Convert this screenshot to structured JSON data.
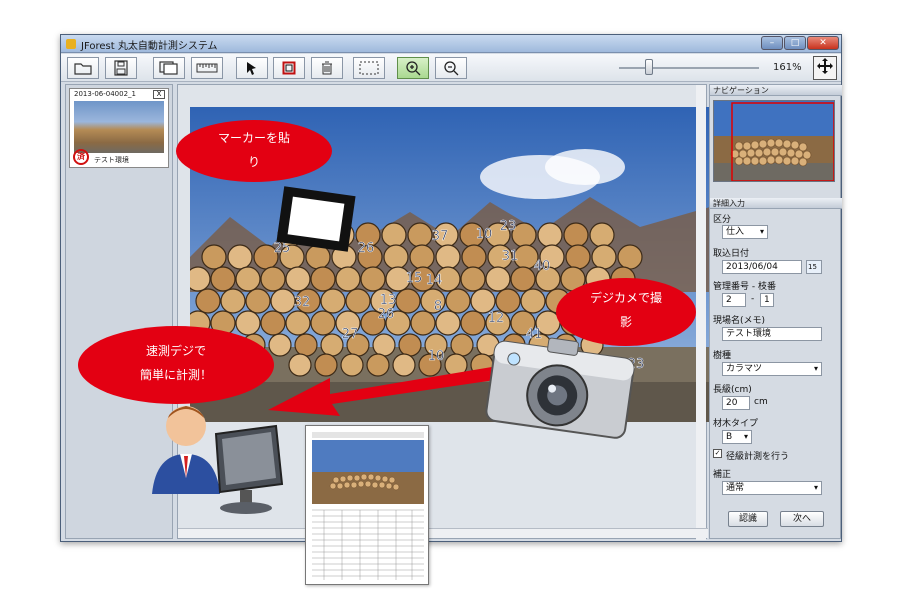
{
  "window": {
    "title": "JForest 丸太自動計測システム"
  },
  "toolbar": {
    "zoom_value": "161%"
  },
  "thumbnail": {
    "title": "2013-06-04002_1",
    "close": "X",
    "label": "テスト環境",
    "stamp": "済"
  },
  "photo": {
    "marker_numbers": [
      "23",
      "37",
      "10",
      "26",
      "25",
      "31",
      "40",
      "15",
      "14",
      "32",
      "8",
      "26",
      "12",
      "10",
      "27",
      "41",
      "13",
      "23"
    ]
  },
  "nav": {
    "header": "ナビゲーション"
  },
  "details": {
    "header": "詳細入力",
    "category_label": "区分",
    "category_value": "仕入",
    "date_label": "取込日付",
    "date_value": "2013/06/04",
    "date_icon_text": "15",
    "mgmt_label": "管理番号 - 枝番",
    "mgmt_main": "2",
    "mgmt_sep": "-",
    "mgmt_sub": "1",
    "site_label": "現場名(メモ)",
    "site_value": "テスト環境",
    "species_label": "樹種",
    "species_value": "カラマツ",
    "length_label": "長級(cm)",
    "length_value": "20",
    "length_unit": "cm",
    "type_label": "材木タイプ",
    "type_value": "B",
    "diameter_check_label": "径級計測を行う",
    "correction_label": "補正",
    "correction_value": "通常",
    "confirm_button": "認識",
    "next_button": "次へ"
  },
  "callouts": {
    "marker_line1": "マーカーを貼",
    "marker_line2": "り",
    "camera_line1": "デジカメで撮",
    "camera_line2": "影",
    "measure_line1": "速測デジで",
    "measure_line2": "簡単に計測！"
  },
  "colors": {
    "callout": "#e30012",
    "window_border": "#4b5f7a",
    "sky": "#5c86c4",
    "log": "#c8a06a"
  }
}
